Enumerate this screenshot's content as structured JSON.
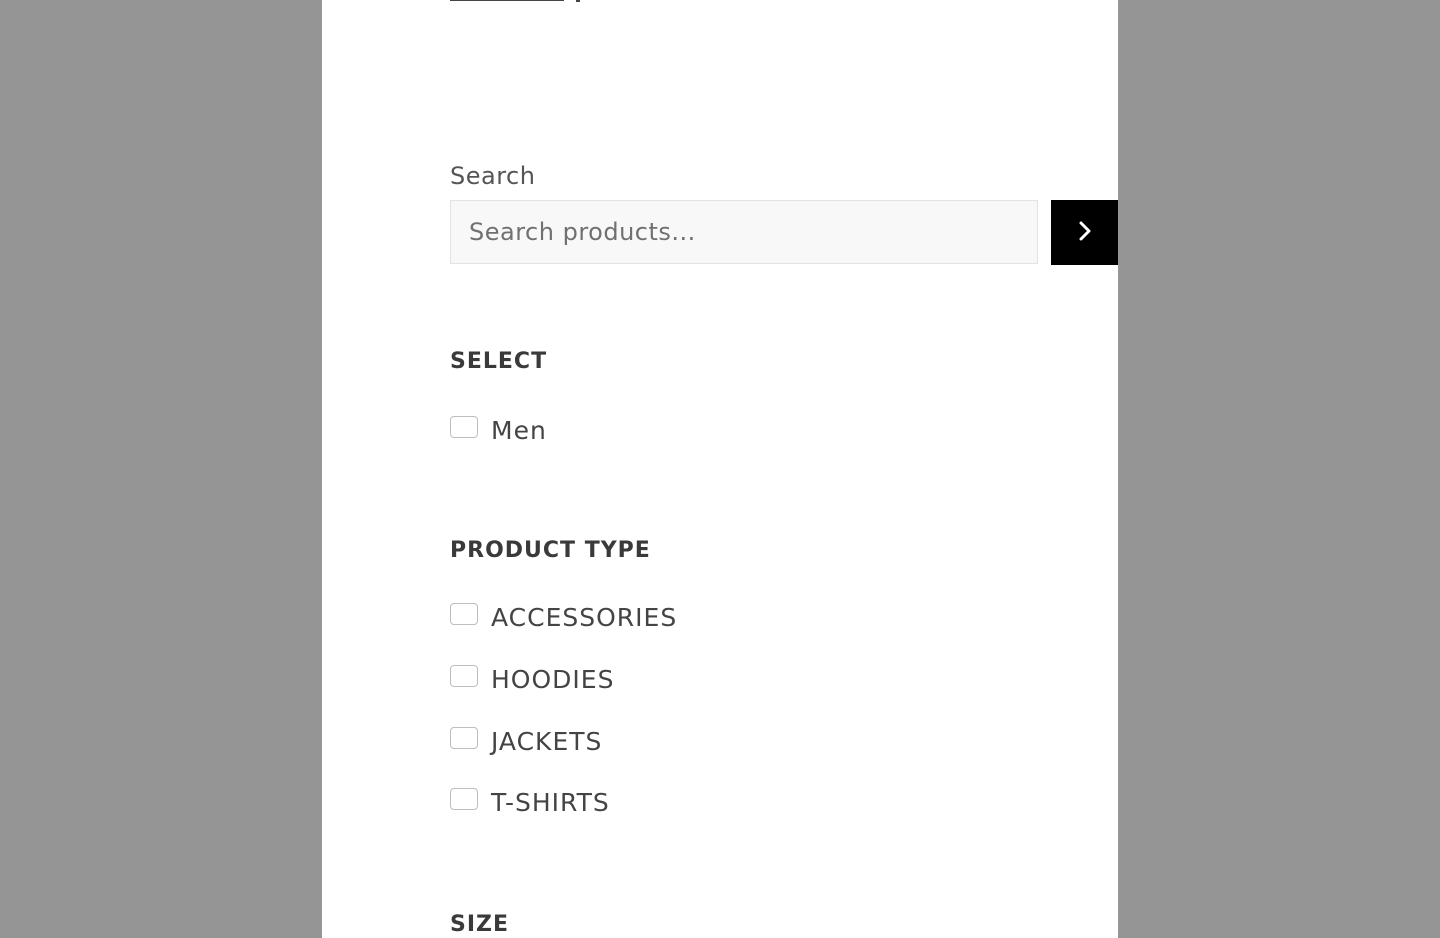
{
  "search": {
    "label": "Search",
    "placeholder": "Search products...",
    "value": ""
  },
  "filters": {
    "select": {
      "heading": "SELECT",
      "options": [
        {
          "label": "Men",
          "checked": false
        }
      ]
    },
    "product_type": {
      "heading": "PRODUCT TYPE",
      "options": [
        {
          "label": "ACCESSORIES",
          "checked": false
        },
        {
          "label": "HOODIES",
          "checked": false
        },
        {
          "label": "JACKETS",
          "checked": false
        },
        {
          "label": "T-SHIRTS",
          "checked": false
        }
      ]
    },
    "size": {
      "heading": "SIZE"
    }
  },
  "icons": {
    "search_submit": "chevron-right-icon"
  },
  "colors": {
    "backdrop": "#959595",
    "panel": "#ffffff",
    "button": "#000000"
  }
}
